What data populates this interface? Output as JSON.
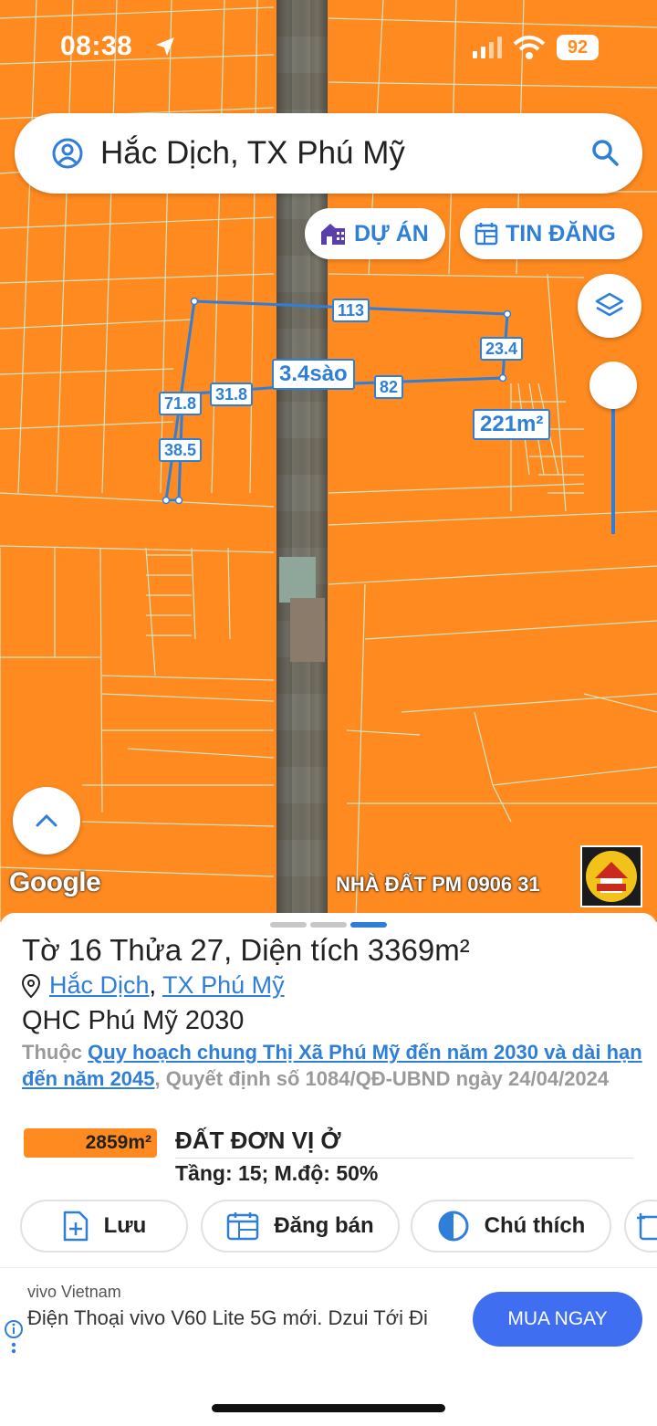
{
  "status_bar": {
    "time": "08:38",
    "battery": "92"
  },
  "search": {
    "query": "Hắc Dịch, TX Phú Mỹ"
  },
  "map_buttons": {
    "du_an": "DỰ ÁN",
    "tin_dang": "TIN ĐĂNG"
  },
  "measurements": {
    "top_edge": "113",
    "right_edge": "23.4",
    "area_label": "3.4sào",
    "mid_left": "31.8",
    "mid_right": "82",
    "left_upper": "71.8",
    "left_lower": "38.5",
    "small_area": "221m²"
  },
  "map_footer": {
    "google": "Google",
    "watermark": "NHÀ ĐẤT PM 0906 31"
  },
  "sheet": {
    "title": "Tờ 16 Thửa 27, Diện tích 3369m²",
    "location_commune": "Hắc Dịch",
    "location_separator": ",",
    "location_town": "TX Phú Mỹ",
    "plan_name": "QHC Phú Mỹ 2030",
    "plan_desc_prefix": "Thuộc ",
    "plan_desc_link": "Quy hoạch chung Thị Xã Phú Mỹ đến năm 2030 và dài hạn đến năm 2045",
    "plan_desc_suffix": ", Quyết định số 1084/QĐ-UBND ngày 24/04/2024",
    "land_area": "2859m²",
    "land_type": "ĐẤT ĐƠN VỊ Ở",
    "land_detail": "Tầng: 15; M.độ: 50%",
    "actions": {
      "save": "Lưu",
      "post_sell": "Đăng bán",
      "legend": "Chú thích"
    }
  },
  "ad": {
    "advertiser": "vivo Vietnam",
    "text": "Điện Thoại vivo V60 Lite 5G mới. Dzui Tới Đi",
    "cta": "MUA NGAY"
  },
  "colors": {
    "map_orange": "#ff8a1f",
    "accent_blue": "#2f7fd9",
    "cta_blue": "#3f6ff0"
  }
}
